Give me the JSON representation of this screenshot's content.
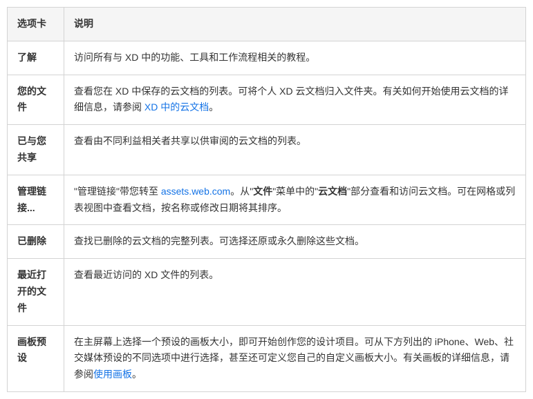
{
  "headers": {
    "col0": "选项卡",
    "col1": "说明"
  },
  "rows": [
    {
      "label": "了解",
      "desc_parts": [
        {
          "text": "访问所有与 XD 中的功能、工具和工作流程相关的教程。"
        }
      ]
    },
    {
      "label": "您的文件",
      "desc_parts": [
        {
          "text": "查看您在 XD 中保存的云文档的列表。可将个人 XD 云文档归入文件夹。有关如何开始使用云文档的详细信息，请参阅 "
        },
        {
          "text": "XD 中的云文档",
          "link": true
        },
        {
          "text": "。"
        }
      ]
    },
    {
      "label": "已与您共享",
      "desc_parts": [
        {
          "text": "查看由不同利益相关者共享以供审阅的云文档的列表。"
        }
      ]
    },
    {
      "label": "管理链接...",
      "desc_parts": [
        {
          "text": "\"管理链接\"带您转至 "
        },
        {
          "text": "assets.web.com",
          "link": true
        },
        {
          "text": "。从\""
        },
        {
          "text": "文件",
          "bold": true
        },
        {
          "text": "\"菜单中的\""
        },
        {
          "text": "云文档",
          "bold": true
        },
        {
          "text": "\"部分查看和访问云文档。可在网格或列表视图中查看文档，按名称或修改日期将其排序。"
        }
      ]
    },
    {
      "label": "已删除",
      "desc_parts": [
        {
          "text": "查找已删除的云文档的完整列表。可选择还原或永久删除这些文档。"
        }
      ]
    },
    {
      "label": "最近打开的文件",
      "desc_parts": [
        {
          "text": "查看最近访问的 XD 文件的列表。"
        }
      ]
    },
    {
      "label": "画板预设",
      "desc_parts": [
        {
          "text": "在主屏幕上选择一个预设的画板大小，即可开始创作您的设计项目。可从下方列出的 iPhone、Web、社交媒体预设的不同选项中进行选择，甚至还可定义您自己的自定义画板大小。有关画板的详细信息，请参阅"
        },
        {
          "text": "使用画板",
          "link": true
        },
        {
          "text": "。"
        }
      ]
    }
  ]
}
